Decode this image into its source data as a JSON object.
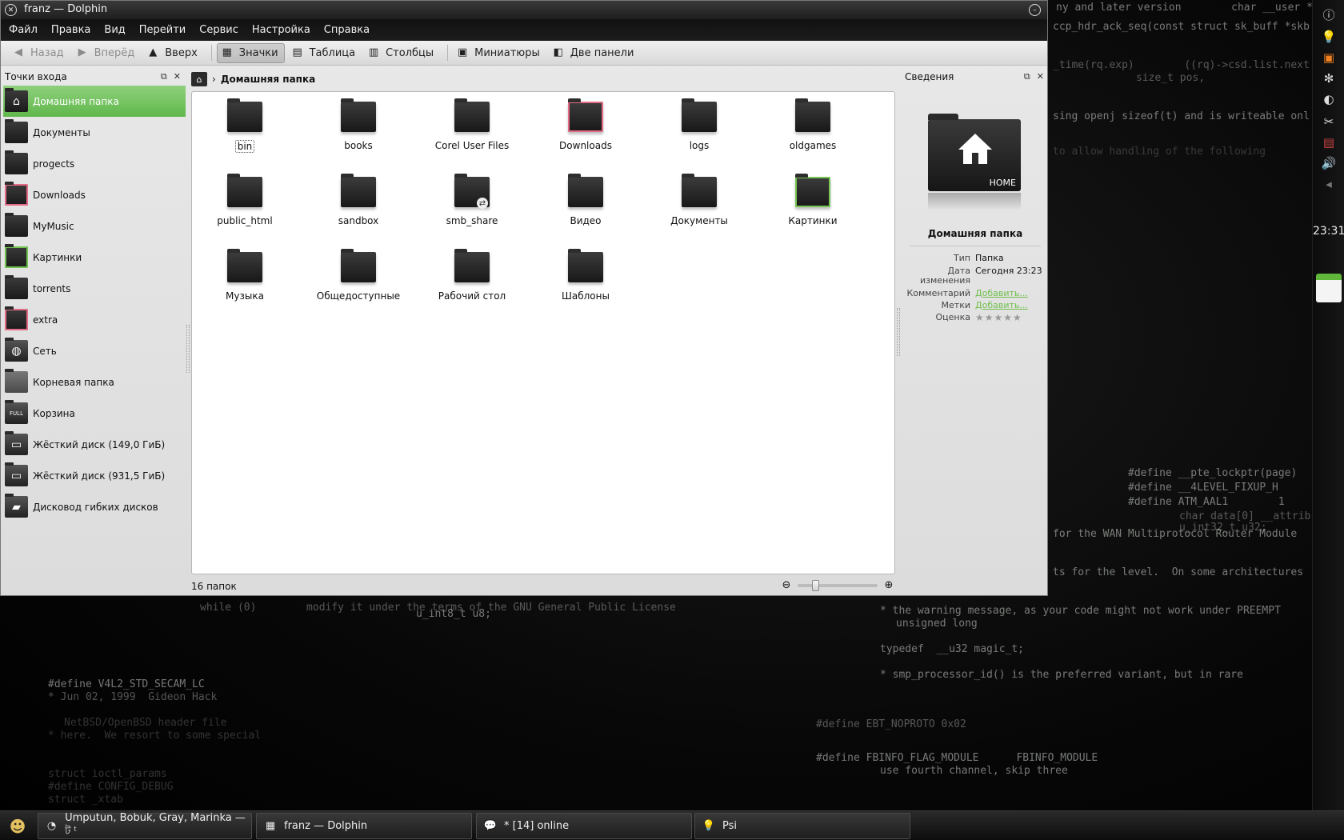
{
  "window": {
    "title": "franz — Dolphin"
  },
  "menubar": [
    "Файл",
    "Правка",
    "Вид",
    "Перейти",
    "Сервис",
    "Настройка",
    "Справка"
  ],
  "toolbar": {
    "back": "Назад",
    "forward": "Вперёд",
    "up": "Вверх",
    "icons": "Значки",
    "table": "Таблица",
    "columns": "Столбцы",
    "thumbnails": "Миниатюры",
    "split": "Две панели"
  },
  "places": {
    "title": "Точки входа",
    "items": [
      {
        "label": "Домашняя папка"
      },
      {
        "label": "Документы"
      },
      {
        "label": "progects"
      },
      {
        "label": "Downloads"
      },
      {
        "label": "MyMusic"
      },
      {
        "label": "Картинки"
      },
      {
        "label": "torrents"
      },
      {
        "label": "extra"
      },
      {
        "label": "Сеть"
      },
      {
        "label": "Корневая папка"
      },
      {
        "label": "Корзина",
        "badge": "FULL"
      },
      {
        "label": "Жёсткий диск (149,0 ГиБ)"
      },
      {
        "label": "Жёсткий диск (931,5 ГиБ)"
      },
      {
        "label": "Дисковод гибких дисков"
      }
    ]
  },
  "location": {
    "crumb": "Домашняя папка"
  },
  "files": [
    {
      "name": "bin"
    },
    {
      "name": "books"
    },
    {
      "name": "Corel User Files"
    },
    {
      "name": "Downloads"
    },
    {
      "name": "logs"
    },
    {
      "name": "oldgames"
    },
    {
      "name": "public_html"
    },
    {
      "name": "sandbox"
    },
    {
      "name": "smb_share"
    },
    {
      "name": "Видео"
    },
    {
      "name": "Документы"
    },
    {
      "name": "Картинки"
    },
    {
      "name": "Музыка"
    },
    {
      "name": "Общедоступные"
    },
    {
      "name": "Рабочий стол"
    },
    {
      "name": "Шаблоны"
    }
  ],
  "status": {
    "text": "16 папок"
  },
  "info": {
    "title": "Сведения",
    "preview_label": "HOME",
    "name": "Домашняя папка",
    "type_key": "Тип",
    "type_val": "Папка",
    "date_key": "Дата изменения",
    "date_val": "Сегодня 23:23",
    "comment_key": "Комментарий",
    "comment_val": "Добавить...",
    "tags_key": "Метки",
    "tags_val": "Добавить...",
    "rating_key": "Оценка",
    "rating_val": "★★★★★"
  },
  "tray": {
    "clock": "23:31"
  },
  "taskbar": {
    "tasks": [
      {
        "label": "Umputun, Bobuk, Gray, Marinka — ট ᵗ"
      },
      {
        "label": "franz — Dolphin"
      },
      {
        "label": "* [14] online"
      },
      {
        "label": "Psi"
      }
    ]
  },
  "desktop_code": [
    "ny and later version        char __user *data,",
    "ccp_hdr_ack_seq(const struct sk_buff *skb",
    "_time(rq.exp)        ((rq)->csd.list.next",
    "size_t pos,",
    "sing openj sizeof(t) and is writeable onl",
    "to allow handling of the following",
    "#define __pte_lockptr(page)",
    "#define __4LEVEL_FIXUP_H",
    "#define ATM_AAL1        1",
    "char data[0] __attrib",
    "u_int32_t u32;",
    "for the WAN Multiprotocol Router Module",
    "ts for the level.  On some architectures",
    "while (0)        modify it under the terms of the GNU General Public License",
    "u_int8_t u8;",
    "* the warning message, as your code might not work under PREEMPT",
    "unsigned long",
    "typedef  __u32 magic_t;",
    "* smp_processor_id() is the preferred variant, but in rare",
    "#define EBT_NOPROTO 0x02",
    "#define FBINFO_FLAG_MODULE      FBINFO_MODULE",
    "use fourth channel, skip three",
    "#define V4L2_STD_SECAM_LC",
    "* Jun 02, 1999  Gideon Hack",
    "NetBSD/OpenBSD header file",
    "* here.  We resort to some special",
    "struct ioctl_params",
    "#define CONFIG_DEBUG",
    "struct _xtab"
  ]
}
